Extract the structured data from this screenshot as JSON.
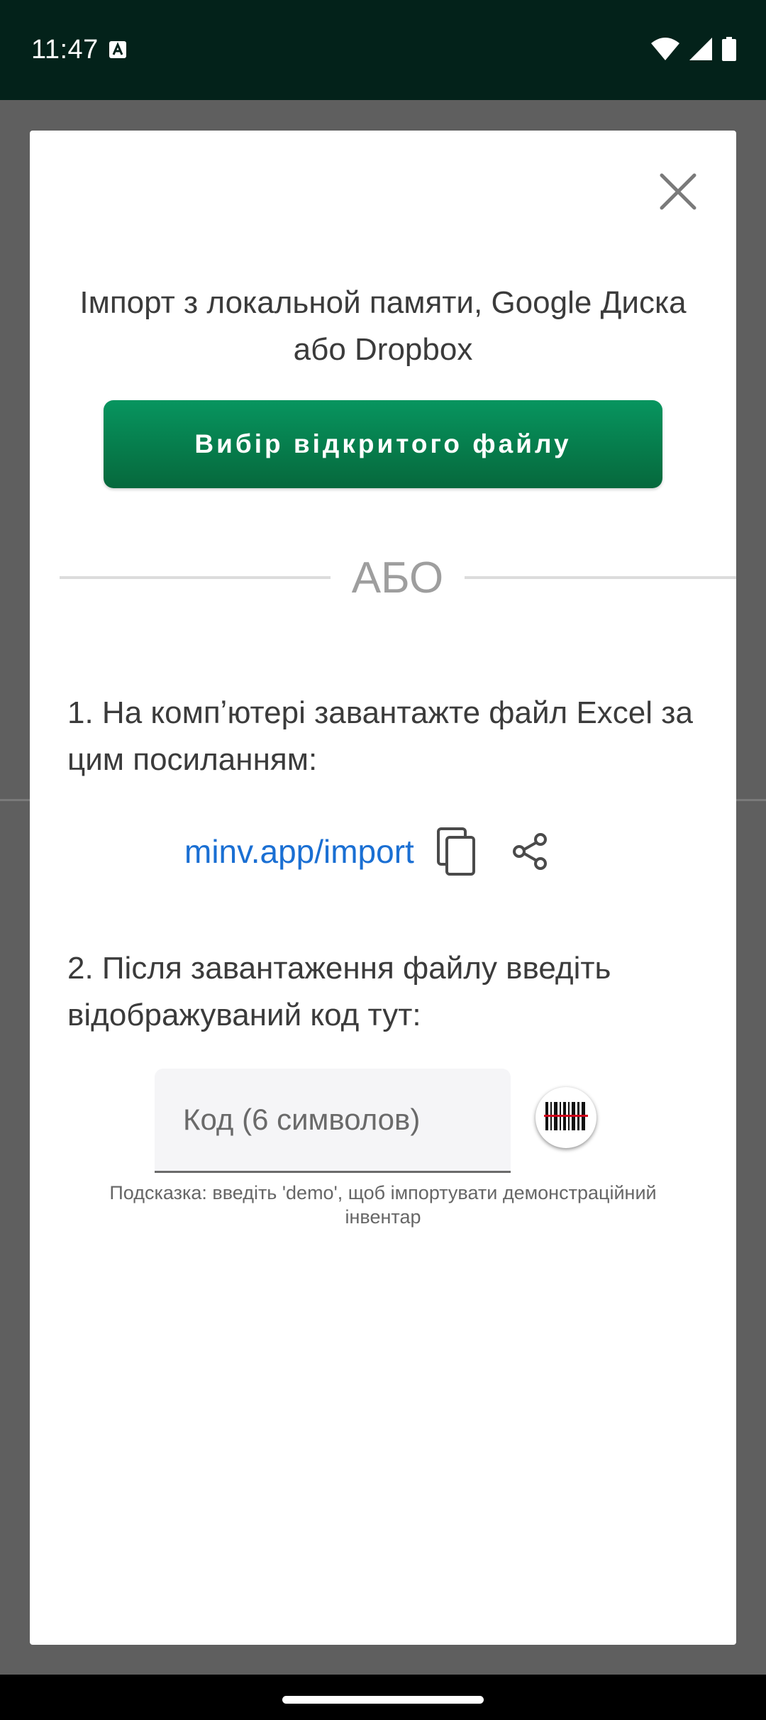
{
  "status_bar": {
    "time": "11:47",
    "icons": [
      "text-a-icon",
      "wifi-icon",
      "signal-icon",
      "battery-icon"
    ]
  },
  "dialog": {
    "close_icon": "close-icon",
    "title": "Імпорт з локальной памяти, Google Диска або Dropbox",
    "choose_file_button": "Вибір відкритого файлу",
    "or_label": "АБО",
    "step1": "1. На компʼютері завантажте файл Excel за цим посиланням:",
    "link": {
      "text": "minv.app/import",
      "copy_icon": "copy-icon",
      "share_icon": "share-icon"
    },
    "step2": "2. Після завантаження файлу введіть відображуваний код тут:",
    "code_input": {
      "placeholder": "Код (6 символов)",
      "value": ""
    },
    "scan_icon": "barcode-scan-icon",
    "hint": "Подсказка: введіть 'demo', щоб імпортувати демонстраційний інвентар"
  },
  "colors": {
    "status_bar_bg": "#03221a",
    "primary_button": "#07955f",
    "link": "#1a6fd3",
    "overlay": "#5f5f5f",
    "barcode_line": "#d0021b"
  }
}
